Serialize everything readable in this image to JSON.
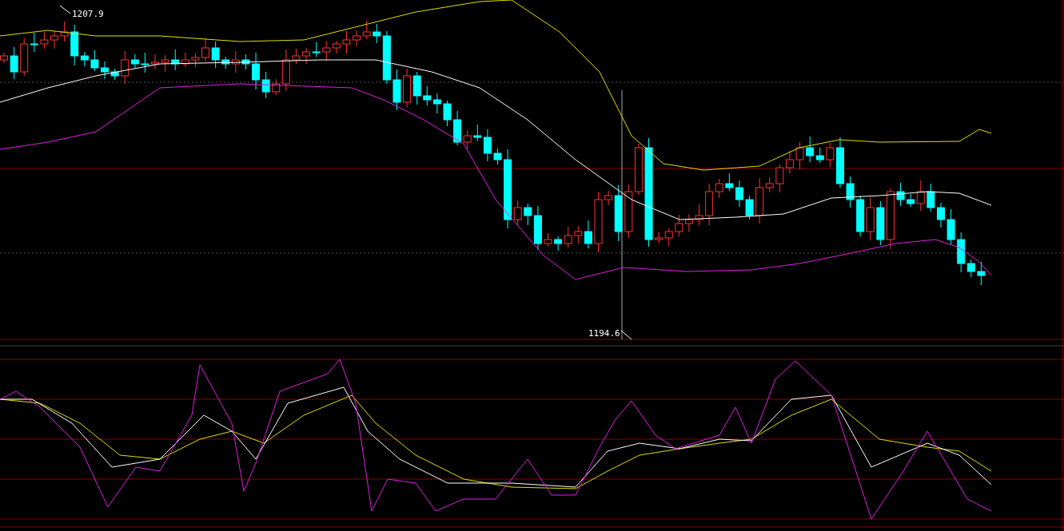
{
  "price_chart": {
    "high_label": "1207.9",
    "low_label": "1194.6"
  }
}
